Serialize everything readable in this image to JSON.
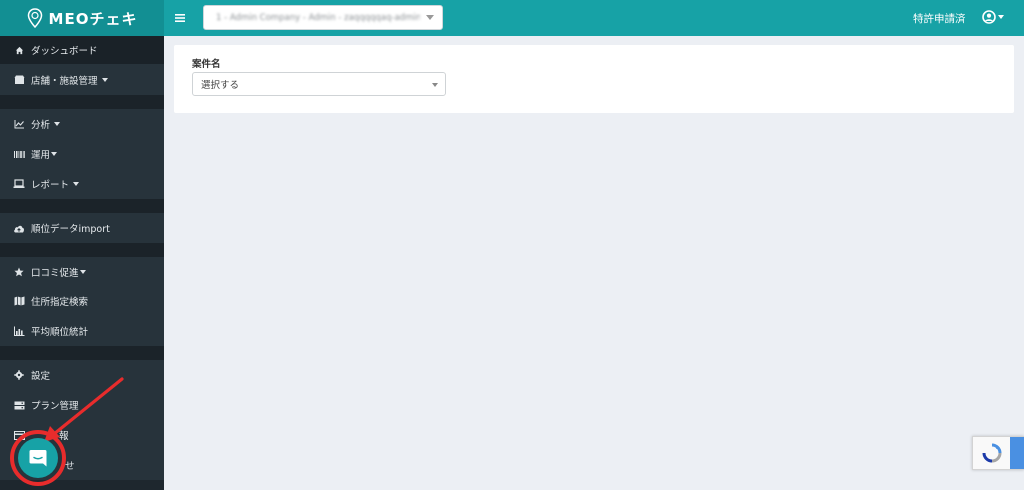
{
  "app": {
    "logo_text": "MEOチェキ",
    "company_select_value": "1 - Admin Company - Admin - zaqqqqqaq-admin@ - -",
    "top_right_link": "特許申請済"
  },
  "sidebar": {
    "items": [
      {
        "label": "ダッシュボード",
        "icon": "home-icon"
      },
      {
        "label": "店舗・施設管理",
        "icon": "store-icon",
        "caret": true
      },
      {
        "label": "分析",
        "icon": "chart-line-icon",
        "caret": true
      },
      {
        "label": "運用",
        "icon": "barcode-icon",
        "caret": true
      },
      {
        "label": "レポート",
        "icon": "laptop-icon",
        "caret": true
      },
      {
        "label": "順位データimport",
        "icon": "cloud-upload-icon"
      },
      {
        "label": "口コミ促進",
        "icon": "star-icon",
        "caret": true
      },
      {
        "label": "住所指定検索",
        "icon": "map-icon"
      },
      {
        "label": "平均順位統計",
        "icon": "bar-chart-icon"
      },
      {
        "label": "設定",
        "icon": "gear-icon"
      },
      {
        "label": "プラン管理",
        "icon": "server-icon"
      },
      {
        "label": "報",
        "icon": "card-icon"
      },
      {
        "label": "せ",
        "icon": "mail-icon"
      }
    ]
  },
  "main": {
    "field_label": "案件名",
    "select_value": "選択する"
  },
  "colors": {
    "topbar": "#17a2a6",
    "sidebar": "#1e272e",
    "highlight": "#e82c2c"
  }
}
